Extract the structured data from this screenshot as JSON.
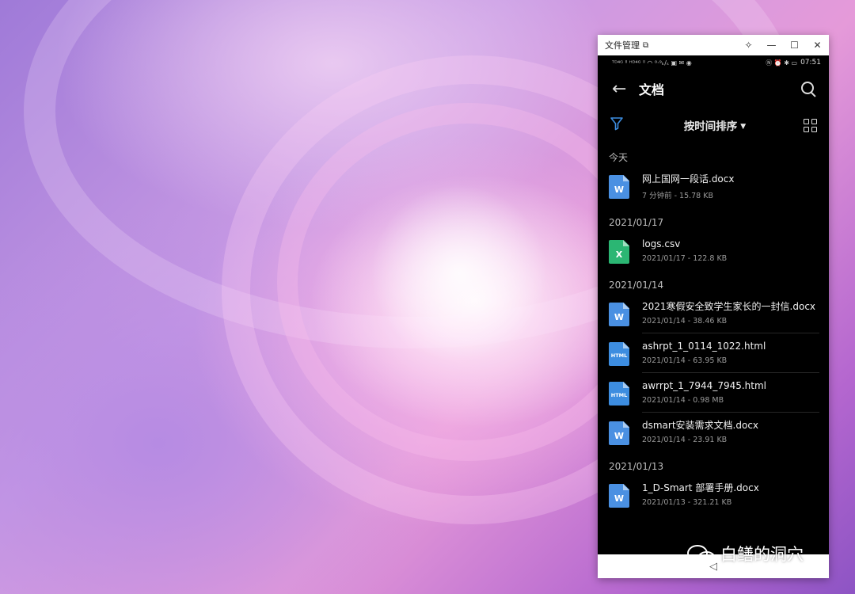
{
  "window": {
    "title": "文件管理",
    "restore_glyph": "⧉",
    "pin_glyph": "✧",
    "minimize_glyph": "—",
    "maximize_glyph": "☐",
    "close_glyph": "✕"
  },
  "status_bar": {
    "left_indicators": "ᵀᴰ⁴ᴳ ˡˡ ᴴᴰ⁴ᴳ ˡˡ ◠ ⁰·⁹ₖ/ₛ ▣ ✉ ◉",
    "right_indicators": "Ⓝ ⏰ ✱ ▭",
    "time": "07:51"
  },
  "app_bar": {
    "back_glyph": "←",
    "title": "文档"
  },
  "sort_bar": {
    "label": "按时间排序",
    "caret": "▼"
  },
  "sections": [
    {
      "header": "今天",
      "items": [
        {
          "name": "网上国网一段话.docx",
          "meta": "7 分钟前 - 15.78 KB",
          "type": "word",
          "icon_text": "W",
          "color": "#4a90e2"
        }
      ]
    },
    {
      "header": "2021/01/17",
      "items": [
        {
          "name": "logs.csv",
          "meta": "2021/01/17 - 122.8 KB",
          "type": "excel",
          "icon_text": "X",
          "color": "#2bb673"
        }
      ]
    },
    {
      "header": "2021/01/14",
      "items": [
        {
          "name": "2021寒假安全致学生家长的一封信.docx",
          "meta": "2021/01/14 - 38.46 KB",
          "type": "word",
          "icon_text": "W",
          "color": "#4a90e2"
        },
        {
          "name": "ashrpt_1_0114_1022.html",
          "meta": "2021/01/14 - 63.95 KB",
          "type": "html",
          "icon_text": "HTML",
          "color": "#3d8de0"
        },
        {
          "name": "awrrpt_1_7944_7945.html",
          "meta": "2021/01/14 - 0.98 MB",
          "type": "html",
          "icon_text": "HTML",
          "color": "#3d8de0"
        },
        {
          "name": "dsmart安装需求文档.docx",
          "meta": "2021/01/14 - 23.91 KB",
          "type": "word",
          "icon_text": "W",
          "color": "#4a90e2"
        }
      ]
    },
    {
      "header": "2021/01/13",
      "items": [
        {
          "name": "1_D-Smart 部署手册.docx",
          "meta": "2021/01/13 - 321.21 KB",
          "type": "word",
          "icon_text": "W",
          "color": "#4a90e2"
        }
      ]
    }
  ],
  "nav_bar": {
    "back_glyph": "◁"
  },
  "watermark": {
    "text": "白鳝的洞穴"
  },
  "colors": {
    "accent": "#3d8de0",
    "background": "#000000"
  }
}
